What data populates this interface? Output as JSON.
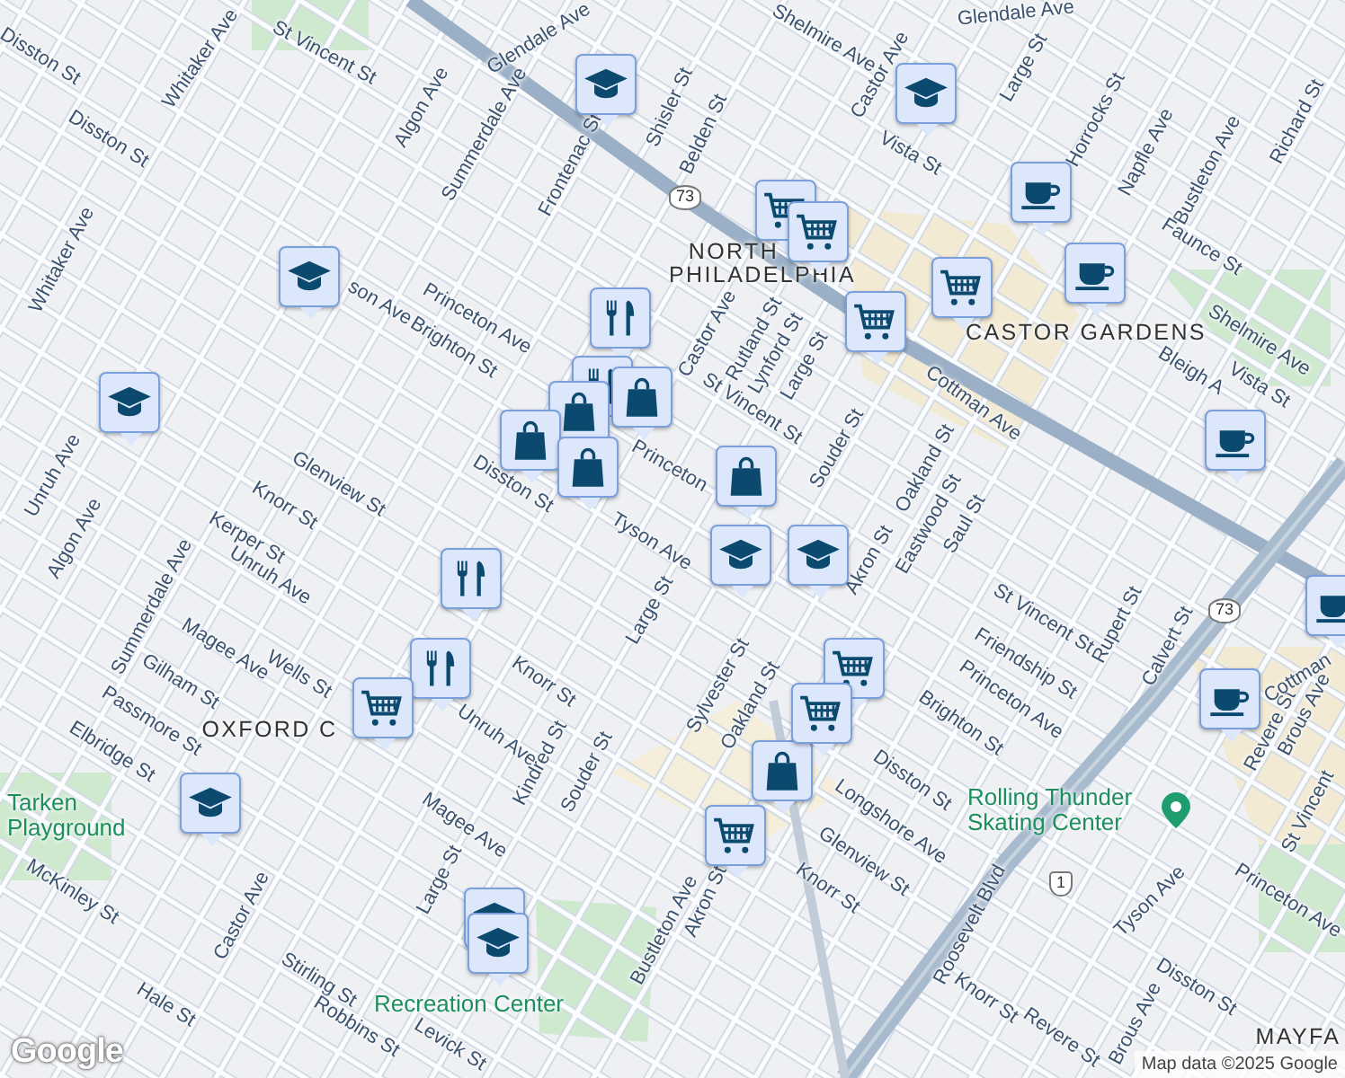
{
  "map": {
    "street_labels": [
      "Whitaker Ave",
      "St Vincent St",
      "Glendale Ave",
      "Glendale Ave",
      "Shelmire Ave",
      "Castor Ave",
      "Large St",
      "Disston St",
      "Algon Ave",
      "Summerdale Ave",
      "Shisler St",
      "Belden St",
      "Frontenac St",
      "Vista St",
      "Horrocks St",
      "Napfle Ave",
      "Bustleton Ave",
      "Richard St",
      "Disston St",
      "Whitaker Ave",
      "son Ave",
      "Princeton Ave",
      "Brighton St",
      "Faunce St",
      "Shelmire Ave",
      "Vista St",
      "Bleigh A",
      "Castor Ave",
      "Rutland St",
      "Lynford St",
      "Large St",
      "St Vincent St",
      "Souder St",
      "Oakland St",
      "Eastwood St",
      "Akron St",
      "Saul St",
      "Princeton",
      "Cottman Ave",
      "Unruh Ave",
      "Algon Ave",
      "Glenview St",
      "Knorr St",
      "Kerper St",
      "Unruh Ave",
      "Disston St",
      "Tyson Ave",
      "Large St",
      "Summerdale Ave",
      "Magee Ave",
      "Gilham St",
      "Wells St",
      "Knorr St",
      "Unruh Ave",
      "Kindred St",
      "Souder St",
      "Magee Ave",
      "Passmore St",
      "Elbridge St",
      "Sylvester St",
      "Oakland St",
      "St Vincent St",
      "Friendship St",
      "Rupert St",
      "Calvert St",
      "Princeton Ave",
      "Brighton St",
      "Disston St",
      "Longshore Ave",
      "Glenview St",
      "Knorr St",
      "Akron St",
      "Revere St",
      "Brous Ave",
      "St Vincent",
      "Tyson Ave",
      "Princeton Ave",
      "Roosevelt Blvd",
      "Bustleton Ave",
      "Large St",
      "Castor Ave",
      "McKinley St",
      "Hale St",
      "Stirling St",
      "Robbins St",
      "Levick St",
      "Knorr St",
      "Revere St",
      "Brous Ave",
      "Disston St",
      "Cottman"
    ],
    "district_labels": [
      "NORTH",
      "PHILADELPHIA",
      "CASTOR GARDENS",
      "OXFORD C",
      "MAYFA"
    ],
    "places": [
      {
        "name": "Tarken Playground",
        "kind": "park"
      },
      {
        "name": "Rolling Thunder Skating Center",
        "kind": "venue"
      },
      {
        "name": "Recreation Center",
        "kind": "park"
      }
    ],
    "route_shields": [
      {
        "number": "73",
        "kind": "state"
      },
      {
        "number": "73",
        "kind": "state"
      },
      {
        "number": "1",
        "kind": "us"
      }
    ],
    "markers": [
      {
        "kind": "school"
      },
      {
        "kind": "school"
      },
      {
        "kind": "school"
      },
      {
        "kind": "school"
      },
      {
        "kind": "school"
      },
      {
        "kind": "school"
      },
      {
        "kind": "school"
      },
      {
        "kind": "school"
      },
      {
        "kind": "school"
      },
      {
        "kind": "cafe"
      },
      {
        "kind": "cafe"
      },
      {
        "kind": "cafe"
      },
      {
        "kind": "cafe"
      },
      {
        "kind": "cafe"
      },
      {
        "kind": "food"
      },
      {
        "kind": "food"
      },
      {
        "kind": "food"
      },
      {
        "kind": "food"
      },
      {
        "kind": "shop"
      },
      {
        "kind": "shop"
      },
      {
        "kind": "shop"
      },
      {
        "kind": "shop"
      },
      {
        "kind": "shop"
      },
      {
        "kind": "shop"
      },
      {
        "kind": "grocery"
      },
      {
        "kind": "grocery"
      },
      {
        "kind": "grocery"
      },
      {
        "kind": "grocery"
      },
      {
        "kind": "grocery"
      },
      {
        "kind": "grocery"
      },
      {
        "kind": "grocery"
      },
      {
        "kind": "grocery"
      }
    ]
  },
  "logo": "Google",
  "attribution": "Map data ©2025 Google"
}
